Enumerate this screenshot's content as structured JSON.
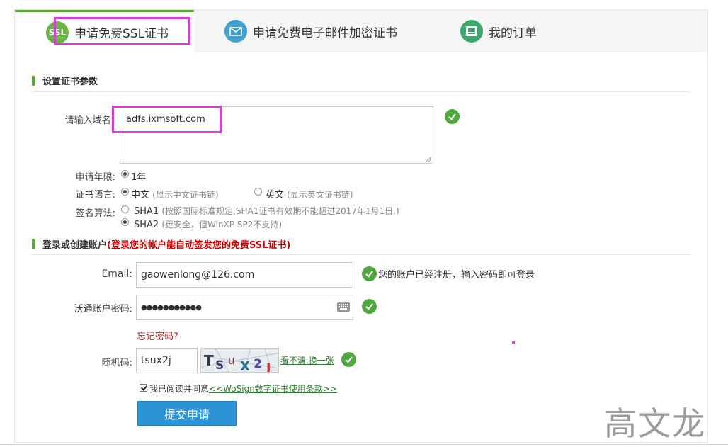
{
  "tabs": [
    {
      "label": "申请免费SSL证书",
      "icon_text": "SSL",
      "icon": "ssl-icon",
      "color": "#6ab446"
    },
    {
      "label": "申请免费电子邮件加密证书",
      "icon": "envelope-icon",
      "color": "#3fa0d3"
    },
    {
      "label": "我的订单",
      "icon": "list-icon",
      "color": "#3aa86a"
    }
  ],
  "cert_section": {
    "title": "设置证书参数",
    "domain_label": "请输入域名:",
    "domain_value": "adfs.ixmsoft.com",
    "years_label": "申请年限:",
    "years_value": "1年",
    "language_label": "证书语言:",
    "language_options": [
      {
        "label": "中文",
        "hint": "(显示中文证书链)",
        "selected": true
      },
      {
        "label": "英文",
        "hint": "(显示英文证书链)",
        "selected": false
      }
    ],
    "algo_label": "签名算法:",
    "algo_options": [
      {
        "label": "SHA1",
        "hint": "(按照国际标准规定,SHA1证书有效期不能超过2017年1月1日.)",
        "selected": false
      },
      {
        "label": "SHA2",
        "hint": "(更安全，但WinXP SP2不支持)",
        "selected": true
      }
    ]
  },
  "account_section": {
    "title": "登录或创建账户",
    "title_note": "(登录您的帐户能自动签发您的免费SSL证书)",
    "email_label": "Email:",
    "email_value": "gaowenlong@126.com",
    "email_msg": "您的账户已经注册，输入密码即可登录",
    "password_label": "沃通账户密码:",
    "password_value": "●●●●●●●●●●●",
    "forgot_label": "忘记密码?",
    "captcha_label": "随机码:",
    "captcha_value": "tsux2j",
    "captcha_image_text": "TSUX2J",
    "captcha_refresh": "看不清,换一张",
    "agree_text": "我已阅读并同意",
    "agree_link": "<<WoSign数字证书使用条款>>",
    "submit_label": "提交申请"
  },
  "watermark": "高文龙"
}
